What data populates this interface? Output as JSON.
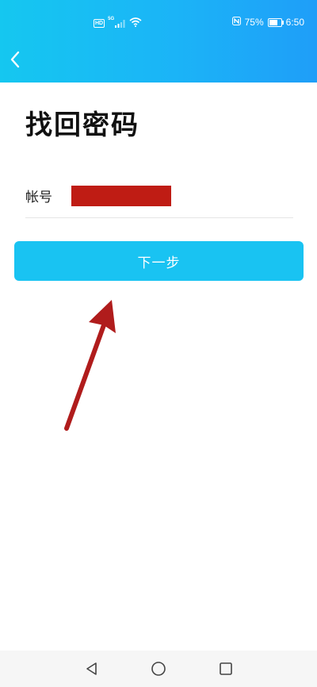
{
  "status_bar": {
    "left_icons": [
      "hd-icon",
      "5g-signal-icon",
      "wifi-icon"
    ],
    "network_badge": "5G",
    "hd_badge": "HD",
    "nfc_icon": "nfc-icon",
    "battery_percent": "75%",
    "battery_level": 0.75,
    "time": "6:50"
  },
  "header": {
    "back_icon": "chevron-left-icon",
    "gradient_start": "#15c7f0",
    "gradient_end": "#1f9ef8"
  },
  "page": {
    "title": "找回密码"
  },
  "form": {
    "account_label": "帐号",
    "account_value_redacted": true,
    "redaction_color": "#bf1c14"
  },
  "actions": {
    "next_label": "下一步",
    "next_color": "#19c3f2"
  },
  "annotation": {
    "arrow_color": "#b01c1c"
  },
  "nav_bar": {
    "buttons": [
      "back-triangle-icon",
      "home-circle-icon",
      "recents-square-icon"
    ]
  }
}
